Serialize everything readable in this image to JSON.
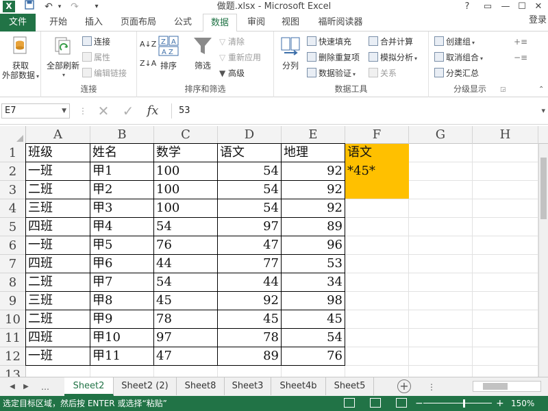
{
  "titlebar": {
    "app_icon": "X",
    "title": "做题.xlsx - Microsoft Excel",
    "quick_access": [
      "save-icon",
      "undo-icon",
      "redo-icon"
    ],
    "window_controls": [
      "?",
      "▭",
      "—",
      "☐",
      "✕"
    ]
  },
  "tabs": {
    "file": "文件",
    "items": [
      "开始",
      "插入",
      "页面布局",
      "公式",
      "数据",
      "审阅",
      "视图",
      "福昕阅读器"
    ],
    "active": "数据",
    "login": "登录"
  },
  "ribbon": {
    "groups": {
      "get_external": {
        "label_line1": "获取",
        "label_line2": "外部数据"
      },
      "connections": {
        "label": "连接",
        "refresh_all_line1": "全部刷新",
        "connections": "连接",
        "properties": "属性",
        "edit_links": "编辑链接"
      },
      "sort_filter": {
        "label": "排序和筛选",
        "sort": "排序",
        "filter": "筛选",
        "clear": "清除",
        "reapply": "重新应用",
        "advanced": "高级"
      },
      "data_tools": {
        "label": "数据工具",
        "text_to_columns": "分列",
        "flash_fill": "快速填充",
        "remove_duplicates": "删除重复项",
        "data_validation": "数据验证",
        "consolidate": "合并计算",
        "what_if": "模拟分析",
        "relationships": "关系"
      },
      "outline": {
        "label": "分级显示",
        "group": "创建组",
        "ungroup": "取消组合",
        "subtotal": "分类汇总"
      }
    }
  },
  "formula_bar": {
    "name_box": "E7",
    "cancel_icon": "✕",
    "enter_icon": "✓",
    "fx": "fx",
    "value": "53"
  },
  "grid": {
    "columns": [
      "A",
      "B",
      "C",
      "D",
      "E",
      "F",
      "G",
      "H"
    ],
    "rows": [
      "1",
      "2",
      "3",
      "4",
      "5",
      "6",
      "7",
      "8",
      "9",
      "10",
      "11",
      "12",
      "13"
    ],
    "header": [
      "班级",
      "姓名",
      "数学",
      "语文",
      "地理"
    ],
    "data": [
      [
        "一班",
        "甲1",
        "100",
        "54",
        "92"
      ],
      [
        "二班",
        "甲2",
        "100",
        "54",
        "92"
      ],
      [
        "三班",
        "甲3",
        "100",
        "54",
        "92"
      ],
      [
        "四班",
        "甲4",
        "54",
        "97",
        "89"
      ],
      [
        "一班",
        "甲5",
        "76",
        "47",
        "96"
      ],
      [
        "四班",
        "甲6",
        "44",
        "77",
        "53"
      ],
      [
        "二班",
        "甲7",
        "54",
        "44",
        "34"
      ],
      [
        "三班",
        "甲8",
        "45",
        "92",
        "98"
      ],
      [
        "二班",
        "甲9",
        "78",
        "45",
        "45"
      ],
      [
        "四班",
        "甲10",
        "97",
        "78",
        "54"
      ],
      [
        "一班",
        "甲11",
        "47",
        "89",
        "76"
      ]
    ],
    "criteria": {
      "header": "语文",
      "value": "*45*",
      "fill": "#FFC000"
    }
  },
  "sheets": {
    "tabs": [
      "Sheet2",
      "Sheet2 (2)",
      "Sheet8",
      "Sheet3",
      "Sheet4b",
      "Sheet5"
    ],
    "active": "Sheet2",
    "add_icon": "+"
  },
  "statusbar": {
    "text": "选定目标区域，然后按 ENTER 或选择“粘贴”",
    "zoom_minus": "−",
    "zoom_plus": "+",
    "zoom": "150%"
  },
  "colors": {
    "excel_green": "#217346",
    "criteria_fill": "#FFC000"
  }
}
